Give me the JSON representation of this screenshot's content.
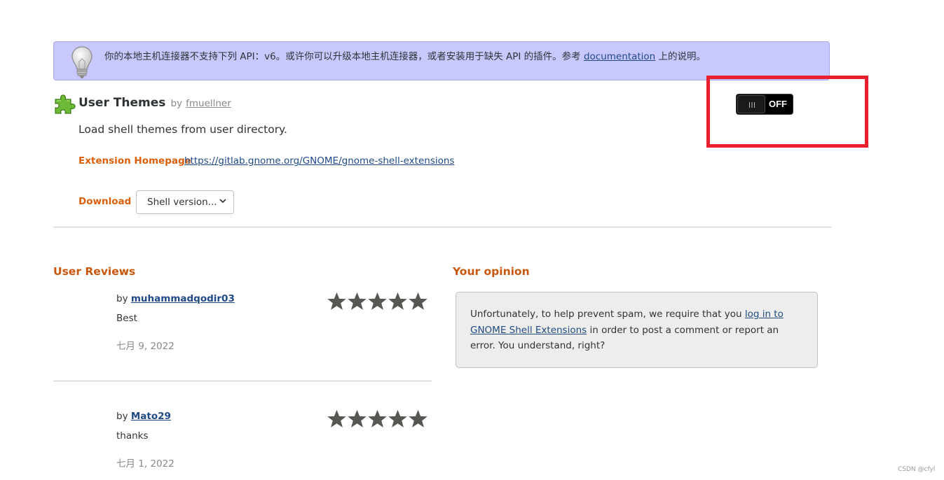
{
  "notice": {
    "message_before_link": "你的本地主机连接器不支持下列 API：v6。或许你可以升级本地主机连接器，或者安装用于缺失 API 的插件。参考",
    "link_text": "documentation",
    "message_after_link": "上的说明。"
  },
  "extension": {
    "name": "User Themes",
    "by_prefix": "by",
    "author": "fmuellner",
    "description": "Load shell themes from user directory.",
    "homepage_label": "Extension Homepage",
    "homepage_url": "https://gitlab.gnome.org/GNOME/gnome-shell-extensions",
    "download_label": "Download",
    "shell_version_placeholder": "Shell version...",
    "toggle_state": "OFF",
    "toggle_grip": "III"
  },
  "reviews": {
    "title": "User Reviews",
    "items": [
      {
        "by_prefix": "by",
        "author": "muhammadqodir03",
        "text": "Best",
        "date": "七月 9, 2022",
        "rating": 5
      },
      {
        "by_prefix": "by",
        "author": "Mato29",
        "text": "thanks",
        "date": "七月 1, 2022",
        "rating": 5
      }
    ]
  },
  "opinion": {
    "title": "Your opinion",
    "text_before_link": "Unfortunately, to help prevent spam, we require that you",
    "link_text": "log in to GNOME Shell Extensions",
    "text_after_link": "in order to post a comment or report an error. You understand, right?"
  },
  "watermark": "CSDN @cfyl",
  "colors": {
    "notice_bg": "#c8c8ff",
    "accent_orange": "#dc5f08",
    "link_blue": "#204a87",
    "highlight_red": "#e8202e",
    "star_gray": "#555753"
  }
}
